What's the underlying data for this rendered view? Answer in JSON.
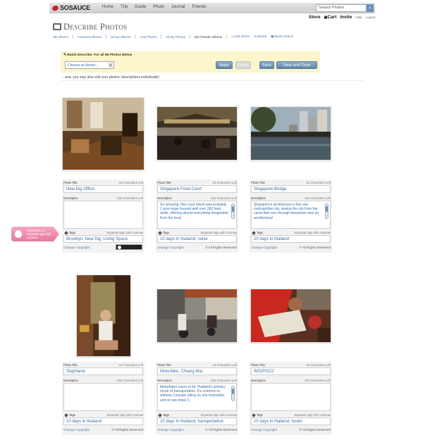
{
  "site": {
    "logo": "SOSAUCE",
    "nav": [
      "Home",
      "Trip",
      "Guide",
      "Photo",
      "Journal",
      "Friends"
    ],
    "search_placeholder": "Search Photos",
    "util": {
      "store": "Store",
      "cart": "Cart",
      "invite": "Invite",
      "help": "Help",
      "logout": "Logout"
    }
  },
  "page": {
    "title": "Describe Photos",
    "subnav": [
      "My Albums",
      "Featured Albums",
      "Group Albums",
      "Lost Photos",
      "All My Photos",
      "My Friends' Albums"
    ],
    "subnav_actions": [
      "Add Album",
      "Upload",
      "Import Videos"
    ]
  },
  "batch": {
    "label": "Batch Describe: For all 68 Photos Below",
    "select_value": "Choose an Action...",
    "apply": "Apply",
    "reset": "Reset",
    "save": "Save",
    "save_close": "Save and Close",
    "note": "...and, you may also edit your photos' descriptions individually!"
  },
  "labels": {
    "photo_title": "Photo Title",
    "description": "Description",
    "tags": "Tags",
    "separate": "Separate tags with commas",
    "change_copyright": "Change Copyright",
    "all_rights": "© All Rights Reserved"
  },
  "reminder": "Remember to separate tags with commas",
  "photos": [
    {
      "title": "New Dig Office",
      "chars_title": "26  Characters Left",
      "chars_desc": "500  Characters Left",
      "description": "",
      "tags": "Brooklyn, New Dig, Living Space",
      "license": "cc"
    },
    {
      "title": "Singapore Food Court",
      "chars_title": "19  Characters Left",
      "chars_desc": "264  Characters Left",
      "description": "So amazing, this court which was probably 1 acre large housed well over 200 food stalls, offering almost everything imaginable from the local",
      "tags": "10 days in thailand, noise",
      "license": "arr"
    },
    {
      "title": "Singapore Bridge",
      "chars_title": "24  Characters Left",
      "chars_desc": "241  Characters Left",
      "description": "Singapore's architecture is like any metropolitan city, seeing the city from the canal that runs through downtown was an architectural",
      "tags": "10 days in thailand",
      "license": "arr"
    },
    {
      "title": "Stephanie",
      "chars_title": "31  Characters Left",
      "chars_desc": "500  Characters Left",
      "description": "",
      "tags": "10 days in thailand",
      "license": "arr"
    },
    {
      "title": "Motorbike, Chiang Mai",
      "chars_title": "19  Characters Left",
      "chars_desc": "294  Characters Left",
      "description": "Motorbikes seem to be Thailand's primary mode of transportation. It's common to witness 3 people riding on one motorbike, and at rare times 5",
      "tags": "10 days in thailand, transportation",
      "license": "arr"
    },
    {
      "title": "IMGP0222",
      "chars_title": "32  Characters Left",
      "chars_desc": "500  Characters Left",
      "description": "",
      "tags": "10 days in thailand, locals",
      "license": "arr"
    }
  ]
}
